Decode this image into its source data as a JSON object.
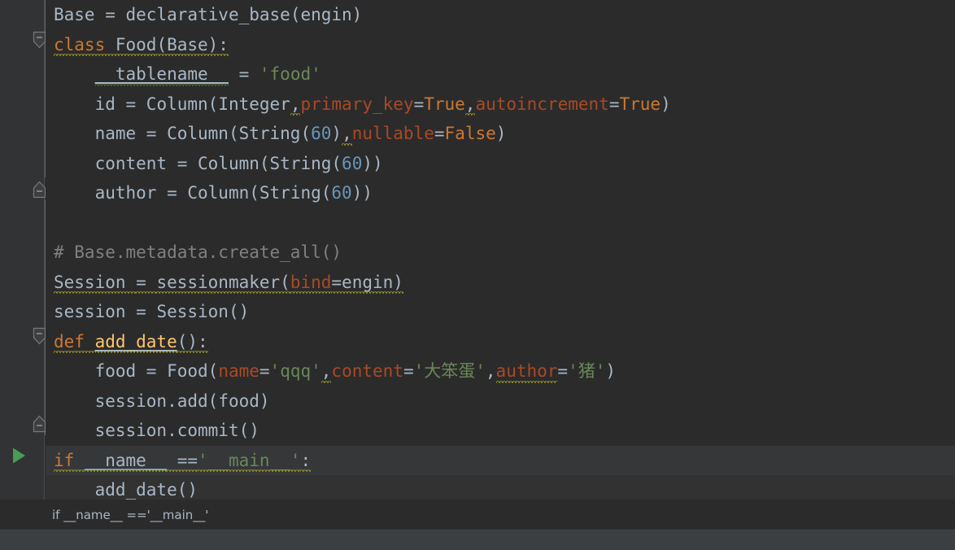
{
  "app": {
    "theme": "Darcula",
    "language": "Python",
    "colors": {
      "editor_background": "#2B2B2B",
      "gutter_background": "#313335",
      "caret_row": "#323232",
      "run_line": "#353739",
      "bottom_panel": "#3C3F41",
      "default_text": "#A9B7C6",
      "keyword": "#CC7832",
      "function_name": "#FFC66D",
      "string": "#6A8759",
      "number": "#6897BB",
      "comment": "#808080",
      "named_argument": "#AA4926",
      "warning_squiggle": "#BBB529",
      "typo_squiggle": "#5F7F3F",
      "run_arrow": "#499C54",
      "bulb": "#F5A623"
    }
  },
  "gutter": {
    "icons": [
      {
        "name": "fold-region-start-class",
        "glyph": "fold-start",
        "line": 2
      },
      {
        "name": "fold-region-end-class",
        "glyph": "fold-end",
        "line": 6
      },
      {
        "name": "fold-region-start-def",
        "glyph": "fold-start",
        "line": 11
      },
      {
        "name": "fold-region-end-def",
        "glyph": "fold-end",
        "line": 14
      },
      {
        "name": "intention-bulb",
        "glyph": "lightbulb",
        "line": 14
      },
      {
        "name": "run-configuration-arrow",
        "glyph": "play-triangle",
        "line": 15
      }
    ]
  },
  "editor": {
    "lines": [
      {
        "n": 1,
        "highlight": "none",
        "tokens": [
          {
            "t": "Base ",
            "c": "ident"
          },
          {
            "t": "= ",
            "c": "punct"
          },
          {
            "t": "declarative_base",
            "c": "ident"
          },
          {
            "t": "(engin)",
            "c": "punct"
          }
        ]
      },
      {
        "n": 2,
        "highlight": "none",
        "tokens": [
          {
            "t": "class ",
            "c": "kw",
            "d": "wavy"
          },
          {
            "t": "Food",
            "c": "cls",
            "d": "wavy"
          },
          {
            "t": "(Base):",
            "c": "punct",
            "d": "wavy"
          }
        ]
      },
      {
        "n": 3,
        "highlight": "none",
        "tokens": [
          {
            "t": "    ",
            "c": "punct"
          },
          {
            "t": "__tablename__",
            "c": "ident",
            "d": "uline-wavy-green"
          },
          {
            "t": " = ",
            "c": "punct"
          },
          {
            "t": "'food'",
            "c": "str"
          }
        ]
      },
      {
        "n": 4,
        "highlight": "none",
        "tokens": [
          {
            "t": "    id = ",
            "c": "ident"
          },
          {
            "t": "Column",
            "c": "ident"
          },
          {
            "t": "(",
            "c": "punct"
          },
          {
            "t": "Integer",
            "c": "ident"
          },
          {
            "t": ",",
            "c": "punct",
            "d": "wavy-comma"
          },
          {
            "t": "primary_key",
            "c": "param"
          },
          {
            "t": "=",
            "c": "punct"
          },
          {
            "t": "True",
            "c": "kw"
          },
          {
            "t": ",",
            "c": "punct",
            "d": "wavy-comma"
          },
          {
            "t": "autoincrement",
            "c": "param"
          },
          {
            "t": "=",
            "c": "punct"
          },
          {
            "t": "True",
            "c": "kw"
          },
          {
            "t": ")",
            "c": "punct"
          }
        ]
      },
      {
        "n": 5,
        "highlight": "none",
        "tokens": [
          {
            "t": "    name = ",
            "c": "ident"
          },
          {
            "t": "Column",
            "c": "ident"
          },
          {
            "t": "(",
            "c": "punct"
          },
          {
            "t": "String",
            "c": "ident"
          },
          {
            "t": "(",
            "c": "punct"
          },
          {
            "t": "60",
            "c": "num"
          },
          {
            "t": ")",
            "c": "punct"
          },
          {
            "t": ",",
            "c": "punct",
            "d": "wavy-comma"
          },
          {
            "t": "nullable",
            "c": "param"
          },
          {
            "t": "=",
            "c": "punct"
          },
          {
            "t": "False",
            "c": "kw"
          },
          {
            "t": ")",
            "c": "punct"
          }
        ]
      },
      {
        "n": 6,
        "highlight": "none",
        "tokens": [
          {
            "t": "    content = ",
            "c": "ident"
          },
          {
            "t": "Column",
            "c": "ident"
          },
          {
            "t": "(",
            "c": "punct"
          },
          {
            "t": "String",
            "c": "ident"
          },
          {
            "t": "(",
            "c": "punct"
          },
          {
            "t": "60",
            "c": "num"
          },
          {
            "t": "))",
            "c": "punct"
          }
        ]
      },
      {
        "n": 7,
        "highlight": "none",
        "tokens": [
          {
            "t": "    author = ",
            "c": "ident"
          },
          {
            "t": "Column",
            "c": "ident"
          },
          {
            "t": "(",
            "c": "punct"
          },
          {
            "t": "String",
            "c": "ident"
          },
          {
            "t": "(",
            "c": "punct"
          },
          {
            "t": "60",
            "c": "num"
          },
          {
            "t": "))",
            "c": "punct"
          }
        ]
      },
      {
        "n": 8,
        "highlight": "none",
        "tokens": [
          {
            "t": "",
            "c": "ident"
          }
        ]
      },
      {
        "n": 9,
        "highlight": "none",
        "tokens": [
          {
            "t": "# Base.metadata.create_all()",
            "c": "comment"
          }
        ]
      },
      {
        "n": 10,
        "highlight": "none",
        "tokens": [
          {
            "t": "Session ",
            "c": "ident",
            "d": "wavy"
          },
          {
            "t": "= ",
            "c": "punct",
            "d": "wavy"
          },
          {
            "t": "sessionmaker",
            "c": "ident",
            "d": "wavy"
          },
          {
            "t": "(",
            "c": "punct",
            "d": "wavy"
          },
          {
            "t": "bind",
            "c": "param",
            "d": "wavy"
          },
          {
            "t": "=engin)",
            "c": "punct",
            "d": "wavy"
          }
        ]
      },
      {
        "n": 11,
        "highlight": "none",
        "tokens": [
          {
            "t": "session = ",
            "c": "ident"
          },
          {
            "t": "Session",
            "c": "ident"
          },
          {
            "t": "()",
            "c": "punct"
          }
        ]
      },
      {
        "n": 12,
        "highlight": "none",
        "tokens": [
          {
            "t": "def ",
            "c": "kw",
            "d": "wavy"
          },
          {
            "t": "add_date",
            "c": "def",
            "d": "wavy-uline"
          },
          {
            "t": "():",
            "c": "punct",
            "d": "wavy"
          }
        ]
      },
      {
        "n": 13,
        "highlight": "none",
        "tokens": [
          {
            "t": "    food = ",
            "c": "ident"
          },
          {
            "t": "Food",
            "c": "ident"
          },
          {
            "t": "(",
            "c": "punct"
          },
          {
            "t": "name",
            "c": "param"
          },
          {
            "t": "=",
            "c": "punct"
          },
          {
            "t": "'qqq'",
            "c": "str"
          },
          {
            "t": ",",
            "c": "punct",
            "d": "wavy-comma"
          },
          {
            "t": "content",
            "c": "param"
          },
          {
            "t": "=",
            "c": "punct"
          },
          {
            "t": "'大笨蛋'",
            "c": "str"
          },
          {
            "t": ",",
            "c": "punct"
          },
          {
            "t": "author",
            "c": "param",
            "d": "wavy"
          },
          {
            "t": "=",
            "c": "punct"
          },
          {
            "t": "'猪'",
            "c": "str"
          },
          {
            "t": ")",
            "c": "punct"
          }
        ]
      },
      {
        "n": 14,
        "highlight": "none",
        "tokens": [
          {
            "t": "    session",
            "c": "ident"
          },
          {
            "t": ".",
            "c": "punct"
          },
          {
            "t": "add",
            "c": "ident"
          },
          {
            "t": "(food)",
            "c": "punct"
          }
        ]
      },
      {
        "n": 15,
        "highlight": "none",
        "tokens": [
          {
            "t": "    session",
            "c": "ident"
          },
          {
            "t": ".",
            "c": "punct"
          },
          {
            "t": "commit",
            "c": "ident"
          },
          {
            "t": "()",
            "c": "punct"
          }
        ]
      },
      {
        "n": 16,
        "highlight": "run",
        "tokens": [
          {
            "t": "if ",
            "c": "kw",
            "d": "wavy"
          },
          {
            "t": "__name__",
            "c": "ident",
            "d": "wavy-uline-blue"
          },
          {
            "t": " ==",
            "c": "punct",
            "d": "wavy"
          },
          {
            "t": "'__main__'",
            "c": "str",
            "d": "wavy"
          },
          {
            "t": ":",
            "c": "punct",
            "d": "wavy"
          }
        ]
      },
      {
        "n": 17,
        "highlight": "caret",
        "tokens": [
          {
            "t": "    add_date",
            "c": "ident"
          },
          {
            "t": "()",
            "c": "punct"
          }
        ]
      }
    ]
  },
  "breadcrumb": {
    "text": "if __name__ =='__main__'"
  },
  "bottom_panel": {
    "label": ""
  }
}
